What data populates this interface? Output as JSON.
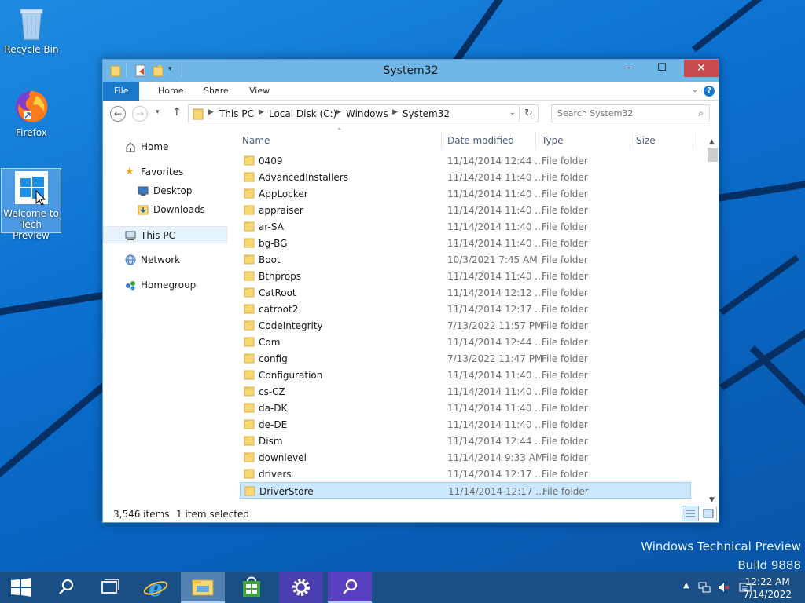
{
  "desktop": {
    "icons": [
      {
        "label": "Recycle Bin"
      },
      {
        "label": "Firefox"
      },
      {
        "label_line1": "Welcome to",
        "label_line2": "Tech Preview"
      }
    ],
    "watermark": {
      "line1": "Windows Technical Preview",
      "line2": "Build 9888"
    }
  },
  "explorer": {
    "title": "System32",
    "ribbon_tabs": [
      "File",
      "Home",
      "Share",
      "View"
    ],
    "breadcrumb": [
      "This PC",
      "Local Disk (C:)",
      "Windows",
      "System32"
    ],
    "search_placeholder": "Search System32",
    "nav": {
      "home": "Home",
      "favorites": "Favorites",
      "desktop": "Desktop",
      "downloads": "Downloads",
      "this_pc": "This PC",
      "network": "Network",
      "homegroup": "Homegroup"
    },
    "columns": {
      "name": "Name",
      "date": "Date modified",
      "type": "Type",
      "size": "Size"
    },
    "files": [
      {
        "name": "0409",
        "date": "11/14/2014 12:44 ...",
        "type": "File folder"
      },
      {
        "name": "AdvancedInstallers",
        "date": "11/14/2014 11:40 ...",
        "type": "File folder"
      },
      {
        "name": "AppLocker",
        "date": "11/14/2014 11:40 ...",
        "type": "File folder"
      },
      {
        "name": "appraiser",
        "date": "11/14/2014 11:40 ...",
        "type": "File folder"
      },
      {
        "name": "ar-SA",
        "date": "11/14/2014 11:40 ...",
        "type": "File folder"
      },
      {
        "name": "bg-BG",
        "date": "11/14/2014 11:40 ...",
        "type": "File folder"
      },
      {
        "name": "Boot",
        "date": "10/3/2021 7:45 AM",
        "type": "File folder"
      },
      {
        "name": "Bthprops",
        "date": "11/14/2014 11:40 ...",
        "type": "File folder"
      },
      {
        "name": "CatRoot",
        "date": "11/14/2014 12:12 ...",
        "type": "File folder"
      },
      {
        "name": "catroot2",
        "date": "11/14/2014 12:17 ...",
        "type": "File folder"
      },
      {
        "name": "CodeIntegrity",
        "date": "7/13/2022 11:57 PM",
        "type": "File folder"
      },
      {
        "name": "Com",
        "date": "11/14/2014 12:44 ...",
        "type": "File folder"
      },
      {
        "name": "config",
        "date": "7/13/2022 11:47 PM",
        "type": "File folder"
      },
      {
        "name": "Configuration",
        "date": "11/14/2014 11:40 ...",
        "type": "File folder"
      },
      {
        "name": "cs-CZ",
        "date": "11/14/2014 11:40 ...",
        "type": "File folder"
      },
      {
        "name": "da-DK",
        "date": "11/14/2014 11:40 ...",
        "type": "File folder"
      },
      {
        "name": "de-DE",
        "date": "11/14/2014 11:40 ...",
        "type": "File folder"
      },
      {
        "name": "Dism",
        "date": "11/14/2014 12:44 ...",
        "type": "File folder"
      },
      {
        "name": "downlevel",
        "date": "11/14/2014 9:33 AM",
        "type": "File folder"
      },
      {
        "name": "drivers",
        "date": "11/14/2014 12:17 ...",
        "type": "File folder"
      },
      {
        "name": "DriverStore",
        "date": "11/14/2014 12:17 ...",
        "type": "File folder",
        "selected": true
      }
    ],
    "status": {
      "items": "3,546 items",
      "selected": "1 item selected"
    }
  },
  "taskbar": {
    "clock_time": "12:22 AM",
    "clock_date": "7/14/2022"
  },
  "colors": {
    "accent": "#1979ca",
    "titlebar": "#6fb7e8",
    "close": "#c74b50",
    "selection": "#cce8ff",
    "folder": "#f8d775"
  }
}
